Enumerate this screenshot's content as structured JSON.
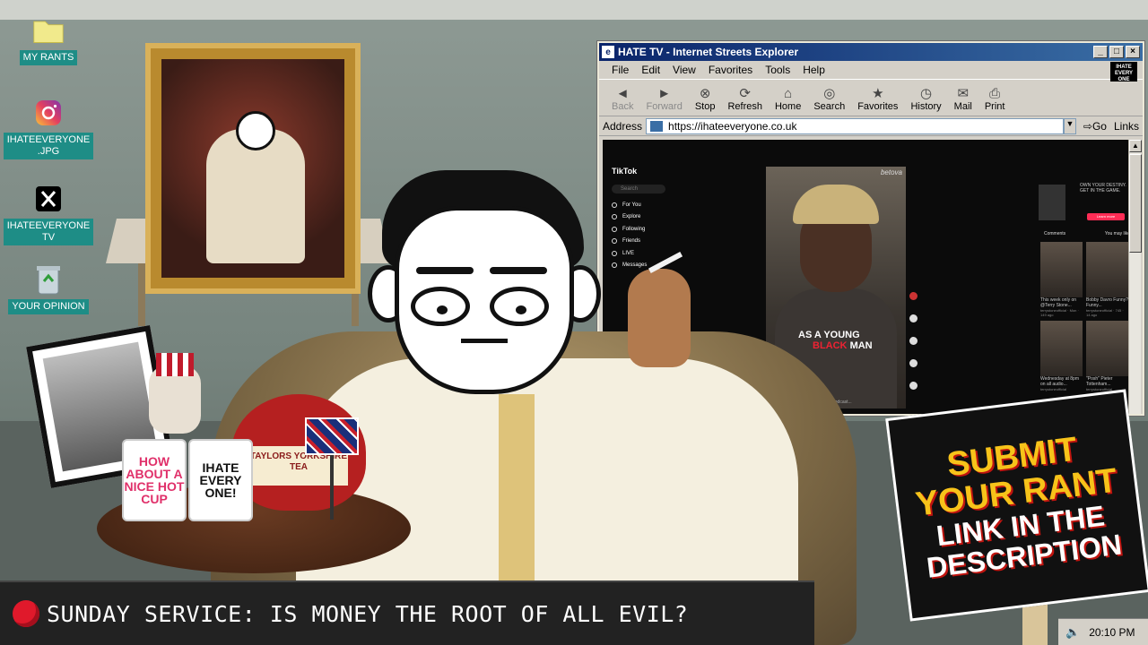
{
  "desktop": {
    "icons": [
      {
        "label": "MY RANTS",
        "icon": "folder-icon"
      },
      {
        "label": "IHATEEVERYONE\n.JPG",
        "icon": "instagram-icon"
      },
      {
        "label": "IHATEEVERYONE\nTV",
        "icon": "x-icon"
      },
      {
        "label": "YOUR OPINION",
        "icon": "recycle-bin-icon"
      }
    ]
  },
  "browser": {
    "title": "HATE TV - Internet Streets Explorer",
    "menu": [
      "File",
      "Edit",
      "View",
      "Favorites",
      "Tools",
      "Help"
    ],
    "brand": "IHATE EVERY ONE",
    "toolbar": [
      "Back",
      "Forward",
      "Stop",
      "Refresh",
      "Home",
      "Search",
      "Favorites",
      "History",
      "Mail",
      "Print"
    ],
    "address_label": "Address",
    "url": "https://ihateeveryone.co.uk",
    "go_label": "Go",
    "links_label": "Links"
  },
  "tiktok": {
    "logo": "TikTok",
    "search_placeholder": "Search",
    "nav": [
      "For You",
      "Explore",
      "Following",
      "Friends",
      "LIVE",
      "Messages"
    ],
    "video_brand": "betova",
    "caption_line1": "AS A YOUNG",
    "caption_word": "BLACK",
    "caption_line2": "MAN",
    "video_footer": "2025-3-26 · Clinical Connection Podcast...",
    "ad_text": "OWN YOUR DESTINY. GET IN THE GAME.",
    "ad_button": "Learn more",
    "tabs": [
      "Comments",
      "You may like"
    ],
    "cards": [
      {
        "title": "This week only on @Terry Stone...",
        "sub": "terrystoneofficial · Mon · 149 ago"
      },
      {
        "title": "Bobby Davro Funny? Funny...",
        "sub": "terrystoneofficial · 745 · 14 ago"
      },
      {
        "title": "Wednesday at 8pm on all audio...",
        "sub": "terrystoneofficial"
      },
      {
        "title": "\"Posh\" Pieter Tottenham...",
        "sub": "terrystoneofficial"
      }
    ]
  },
  "props": {
    "mug1": "HOW ABOUT A NICE HOT CUP",
    "mug2": "IHATE EVERY ONE!",
    "teapot_label": "TAYLORS YORKSHIRE TEA"
  },
  "placard": {
    "line1": "SUBMIT",
    "line2": "YOUR RANT",
    "line3": "LINK IN THE",
    "line4": "DESCRIPTION"
  },
  "ticker": {
    "text": "SUNDAY SERVICE: IS MONEY THE ROOT OF ALL EVIL?"
  },
  "taskbar": {
    "time": "20:10 PM"
  }
}
